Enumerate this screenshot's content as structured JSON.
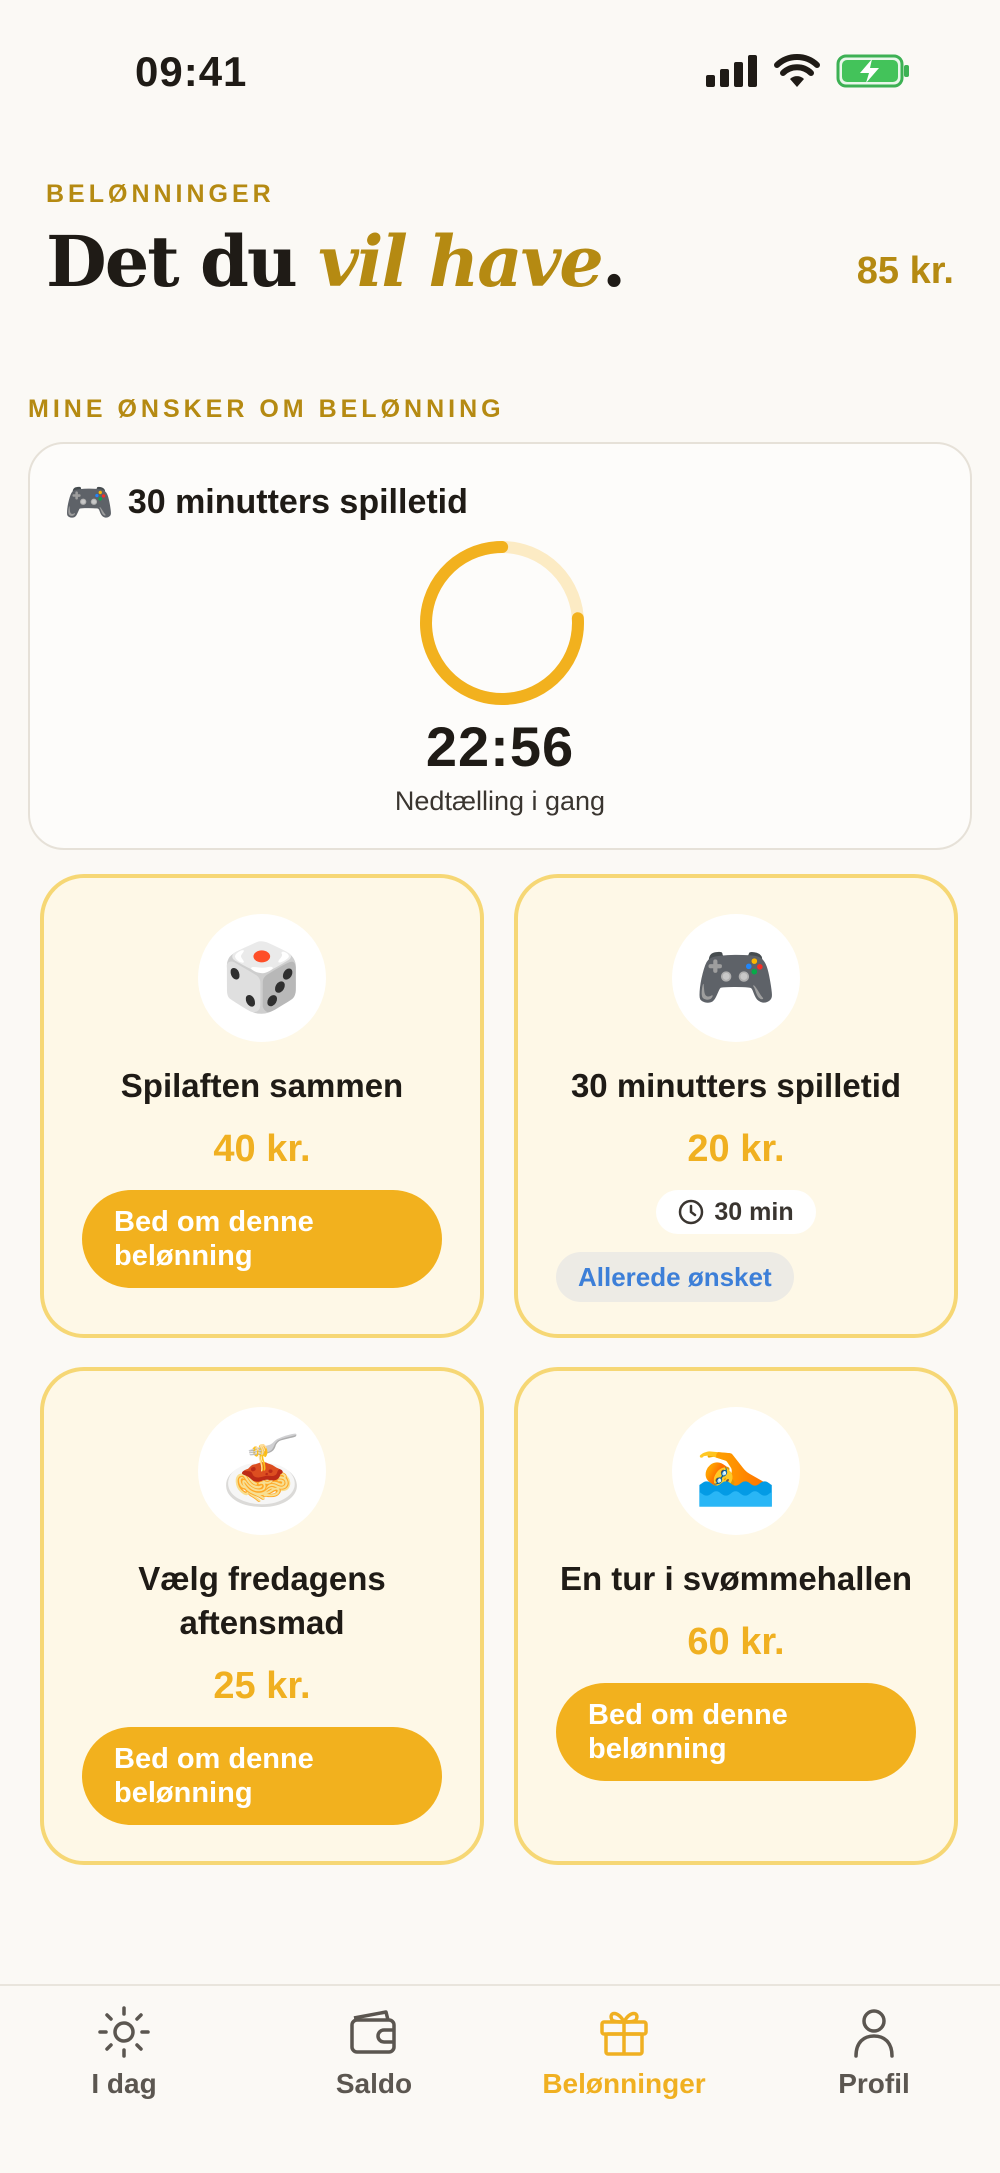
{
  "status_bar": {
    "time": "09:41"
  },
  "header": {
    "eyebrow": "BELØNNINGER",
    "headline_start": "Det du ",
    "headline_emphasis": "vil have",
    "headline_end": ".",
    "balance": "85 kr."
  },
  "section": {
    "title": "MINE ØNSKER OM BELØNNING"
  },
  "countdown": {
    "emoji": "🎮",
    "title": "30 minutters spilletid",
    "time": "22:56",
    "status": "Nedtælling i gang",
    "remaining_fraction": 0.76
  },
  "rewards": [
    {
      "emoji": "🎲",
      "icon": "dice-icon",
      "name": "Spilaften sammen",
      "price": "40 kr.",
      "button": "Bed om denne belønning"
    },
    {
      "emoji": "🎮",
      "icon": "gamepad-icon",
      "name": "30 minutters spilletid",
      "price": "20 kr.",
      "duration": "30 min",
      "status": "Allerede ønsket"
    },
    {
      "emoji": "🍝",
      "icon": "spaghetti-icon",
      "name": "Vælg fredagens aftensmad",
      "price": "25 kr.",
      "button": "Bed om denne belønning"
    },
    {
      "emoji": "🏊",
      "icon": "swimmer-icon",
      "name": "En tur i svømmehallen",
      "price": "60 kr.",
      "button": "Bed om denne belønning"
    }
  ],
  "tabs": [
    {
      "label": "I dag",
      "icon": "sun-icon",
      "active": false
    },
    {
      "label": "Saldo",
      "icon": "wallet-icon",
      "active": false
    },
    {
      "label": "Belønninger",
      "icon": "gift-icon",
      "active": true
    },
    {
      "label": "Profil",
      "icon": "person-icon",
      "active": false
    }
  ],
  "colors": {
    "accent": "#F2B11E",
    "accent_text": "#B58A12",
    "card_bg": "#FEF8E7",
    "card_border": "#F6D775",
    "chip_blue": "#3D7FD8",
    "background": "#FBF9F5"
  }
}
